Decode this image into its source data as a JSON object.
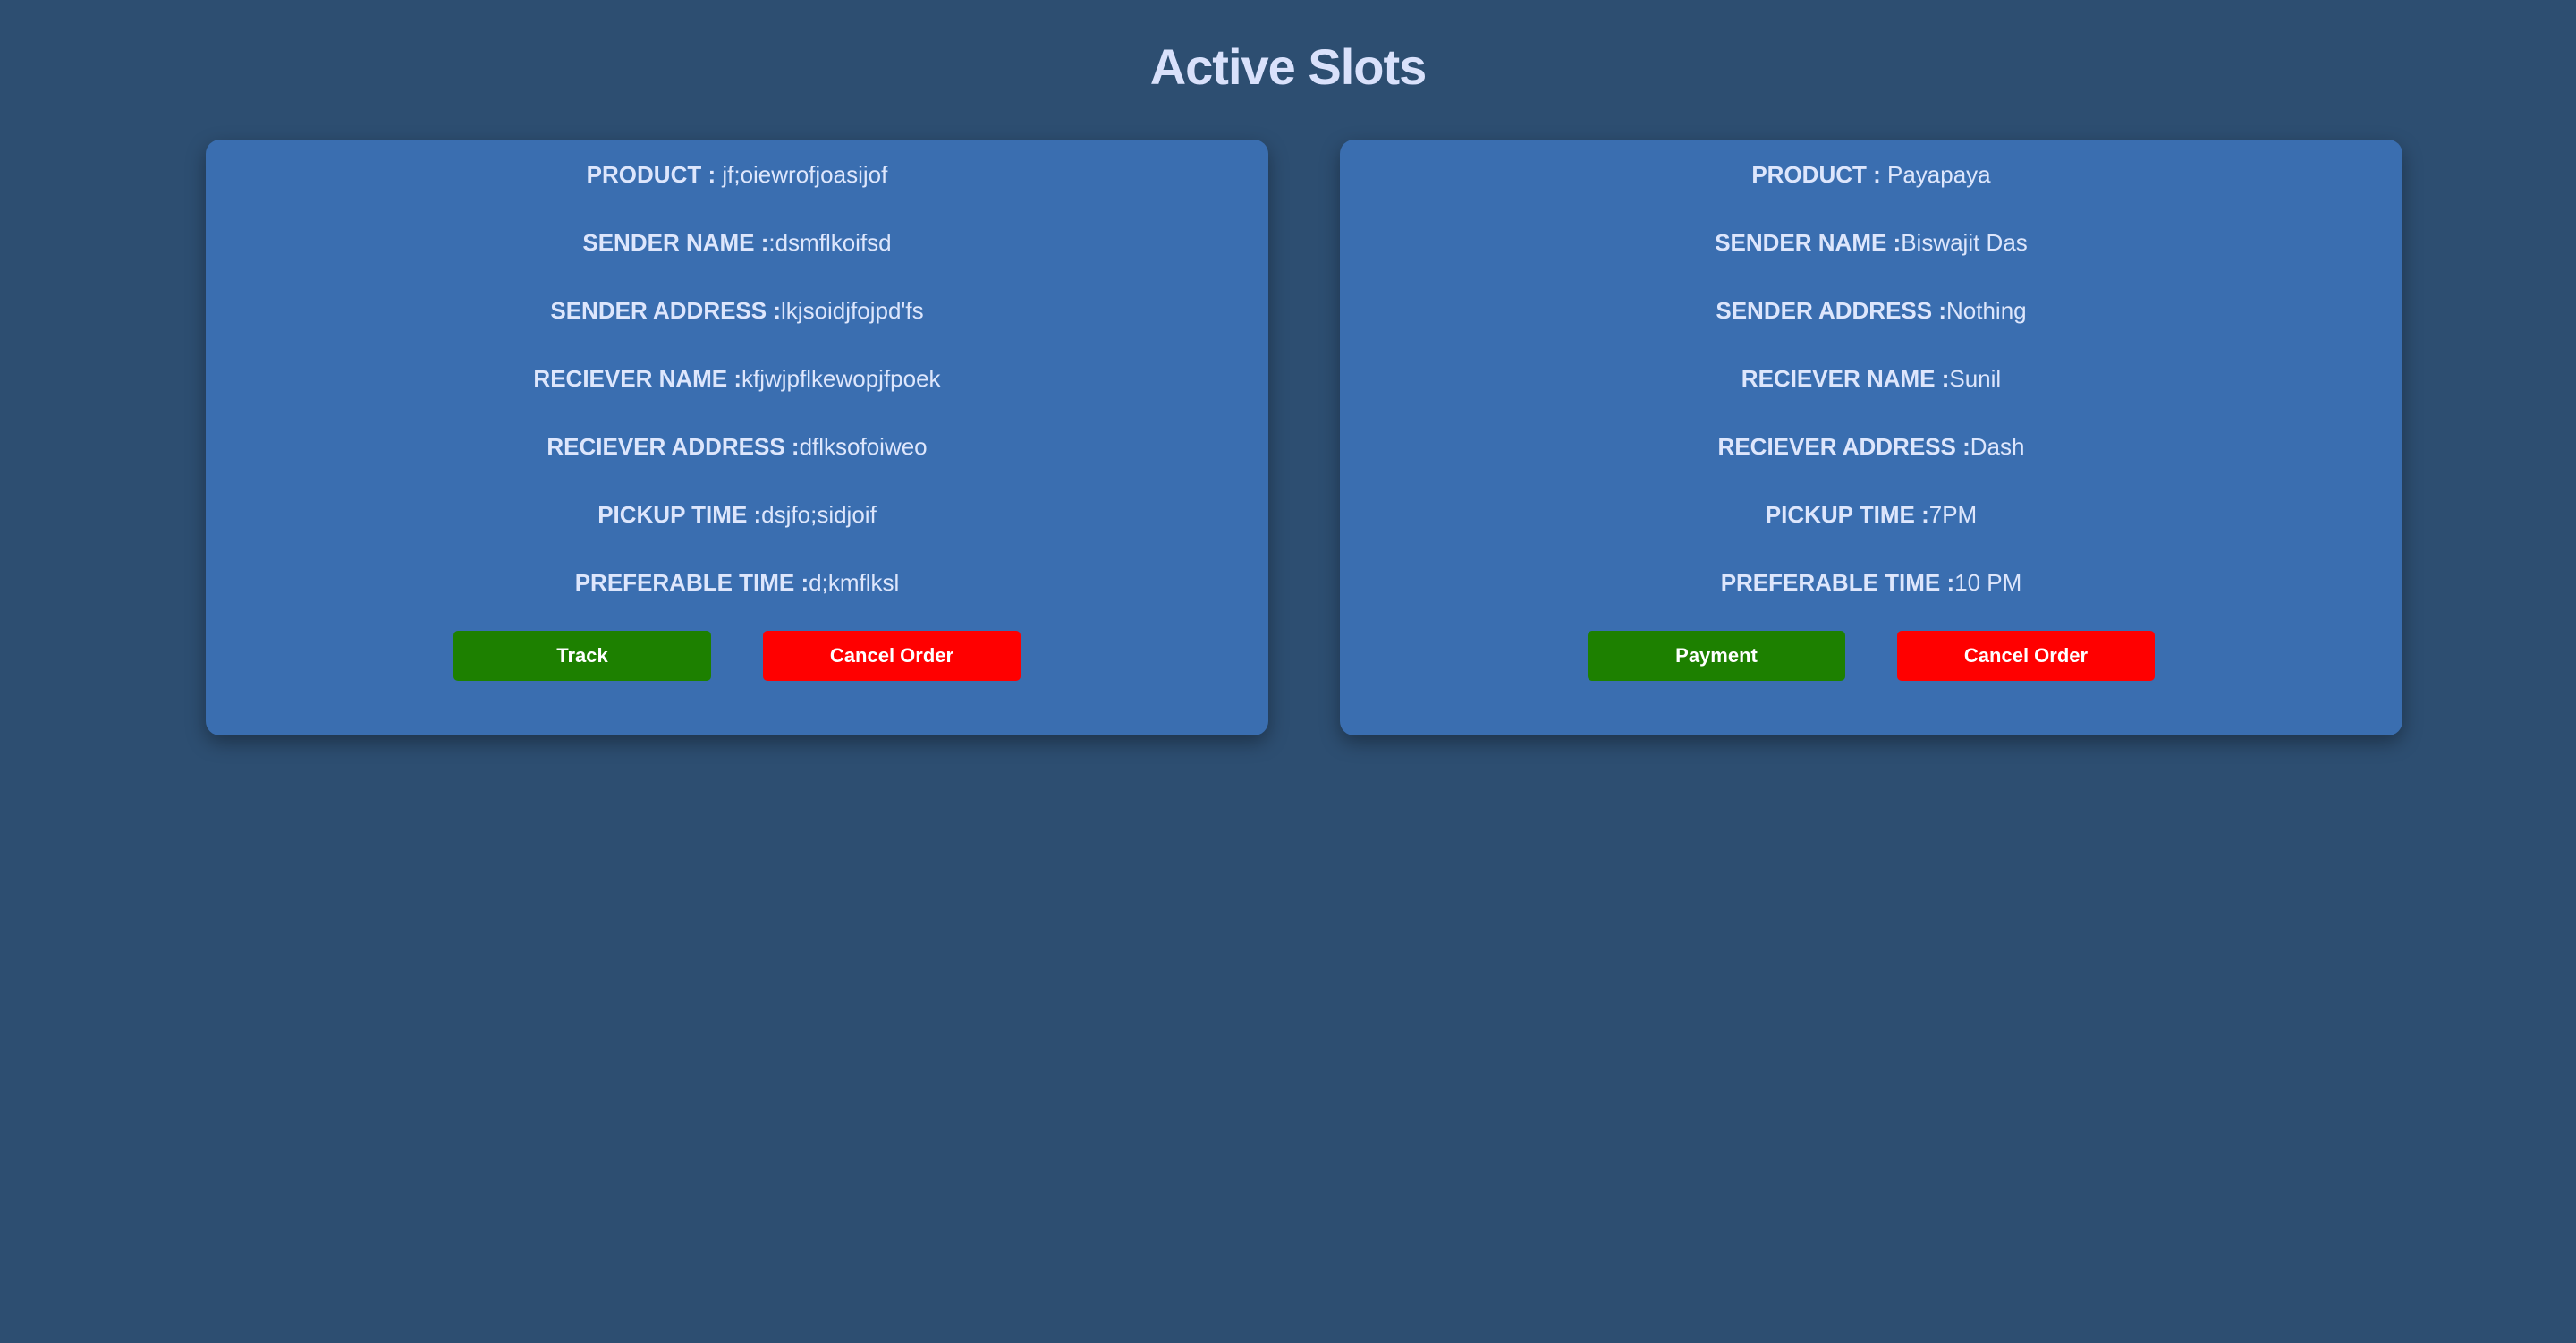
{
  "page": {
    "title": "Active Slots"
  },
  "colors": {
    "background": "#2d4e71",
    "card": "#3a6eb0",
    "primary_button": "#1d8000",
    "danger_button": "#ff0000",
    "text": "#dde6fc"
  },
  "slots": [
    {
      "fields": [
        {
          "label": "PRODUCT : ",
          "value": "jf;oiewrofjoasijof"
        },
        {
          "label": "SENDER NAME :",
          "value": ":dsmflkoifsd"
        },
        {
          "label": "SENDER ADDRESS :",
          "value": "lkjsoidjfojpd'fs"
        },
        {
          "label": "RECIEVER NAME :",
          "value": "kfjwjpflkewopjfpoek"
        },
        {
          "label": "RECIEVER ADDRESS :",
          "value": "dflksofoiweo"
        },
        {
          "label": "PICKUP TIME :",
          "value": "dsjfo;sidjoif"
        },
        {
          "label": "PREFERABLE TIME :",
          "value": "d;kmflksl"
        }
      ],
      "primary_button": "Track",
      "cancel_button": "Cancel Order"
    },
    {
      "fields": [
        {
          "label": "PRODUCT : ",
          "value": "Payapaya"
        },
        {
          "label": "SENDER NAME :",
          "value": "Biswajit Das"
        },
        {
          "label": "SENDER ADDRESS :",
          "value": "Nothing"
        },
        {
          "label": "RECIEVER NAME :",
          "value": "Sunil"
        },
        {
          "label": "RECIEVER ADDRESS :",
          "value": "Dash"
        },
        {
          "label": "PICKUP TIME :",
          "value": "7PM"
        },
        {
          "label": "PREFERABLE TIME :",
          "value": "10 PM"
        }
      ],
      "primary_button": "Payment",
      "cancel_button": "Cancel Order"
    }
  ]
}
